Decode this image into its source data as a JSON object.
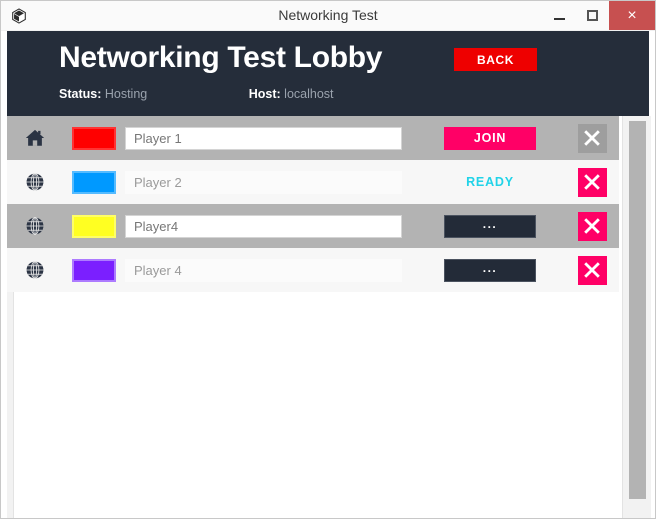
{
  "window": {
    "title": "Networking Test",
    "app_icon": "unity-logo-icon",
    "controls": {
      "minimize": "minimize-icon",
      "maximize": "maximize-icon",
      "close": "×"
    }
  },
  "header": {
    "title": "Networking Test Lobby",
    "back_label": "BACK",
    "status_label": "Status:",
    "status_value": "Hosting",
    "host_label": "Host:",
    "host_value": "localhost",
    "background": "#252d3a",
    "back_color": "#ee0000"
  },
  "players": [
    {
      "icon": "home-icon",
      "color": "#ff0000",
      "color_border": "#ff3333",
      "name": "Player 1",
      "name_editable": true,
      "action_type": "button",
      "action_label": "JOIN",
      "action_color": "#ff0066",
      "kick_label": "✕",
      "kick_enabled": false,
      "row_highlight": true
    },
    {
      "icon": "globe-icon",
      "color": "#0099ff",
      "color_border": "#55bbff",
      "name": "Player 2",
      "name_editable": false,
      "action_type": "text",
      "action_label": "READY",
      "action_color": "#22d3e8",
      "kick_label": "✕",
      "kick_enabled": true,
      "row_highlight": false
    },
    {
      "icon": "globe-icon",
      "color": "#ffff22",
      "color_border": "#ffff66",
      "name": "Player4",
      "name_editable": true,
      "action_type": "button",
      "action_label": "...",
      "action_color": "#232b38",
      "kick_label": "✕",
      "kick_enabled": true,
      "row_highlight": true
    },
    {
      "icon": "globe-icon",
      "color": "#7b1fff",
      "color_border": "#ad7bff",
      "name": "Player 4",
      "name_editable": false,
      "action_type": "button",
      "action_label": "...",
      "action_color": "#232b38",
      "kick_label": "✕",
      "kick_enabled": true,
      "row_highlight": false
    }
  ],
  "scrollbar": {
    "thumb_color": "#b3b3b3",
    "track_color": "#f2f2f2"
  }
}
